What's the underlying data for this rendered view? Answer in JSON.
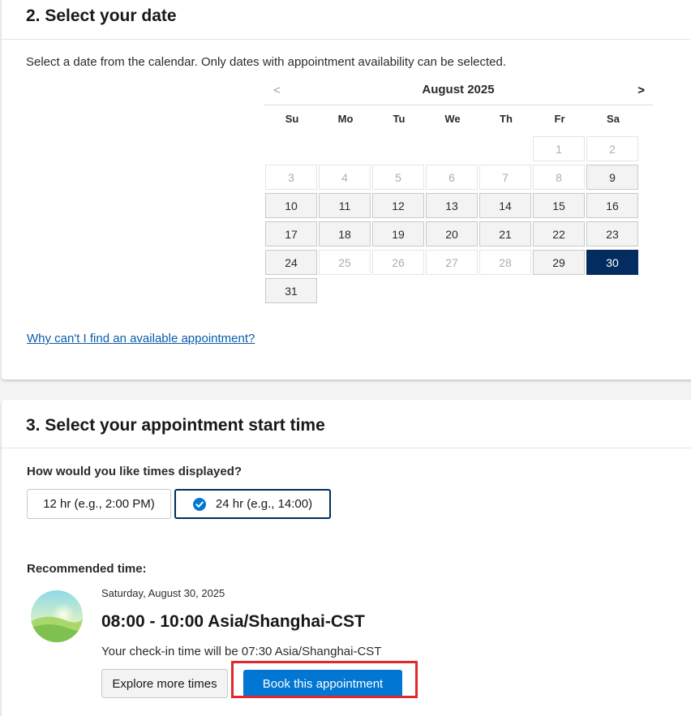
{
  "step2": {
    "title": "2. Select your date",
    "instruction": "Select a date from the calendar. Only dates with appointment availability can be selected.",
    "help_link": "Why can't I find an available appointment?"
  },
  "calendar": {
    "month_label": "August 2025",
    "prev_label": "<",
    "next_label": ">",
    "weekdays": [
      "Su",
      "Mo",
      "Tu",
      "We",
      "Th",
      "Fr",
      "Sa"
    ],
    "first_weekday_index": 5,
    "days": [
      {
        "day": "1",
        "state": "disabled"
      },
      {
        "day": "2",
        "state": "disabled"
      },
      {
        "day": "3",
        "state": "disabled"
      },
      {
        "day": "4",
        "state": "disabled"
      },
      {
        "day": "5",
        "state": "disabled"
      },
      {
        "day": "6",
        "state": "disabled"
      },
      {
        "day": "7",
        "state": "disabled"
      },
      {
        "day": "8",
        "state": "disabled"
      },
      {
        "day": "9",
        "state": "available"
      },
      {
        "day": "10",
        "state": "available"
      },
      {
        "day": "11",
        "state": "available"
      },
      {
        "day": "12",
        "state": "available"
      },
      {
        "day": "13",
        "state": "available"
      },
      {
        "day": "14",
        "state": "available"
      },
      {
        "day": "15",
        "state": "available"
      },
      {
        "day": "16",
        "state": "available"
      },
      {
        "day": "17",
        "state": "available"
      },
      {
        "day": "18",
        "state": "available"
      },
      {
        "day": "19",
        "state": "available"
      },
      {
        "day": "20",
        "state": "available"
      },
      {
        "day": "21",
        "state": "available"
      },
      {
        "day": "22",
        "state": "available"
      },
      {
        "day": "23",
        "state": "available"
      },
      {
        "day": "24",
        "state": "available"
      },
      {
        "day": "25",
        "state": "disabled"
      },
      {
        "day": "26",
        "state": "disabled"
      },
      {
        "day": "27",
        "state": "disabled"
      },
      {
        "day": "28",
        "state": "disabled"
      },
      {
        "day": "29",
        "state": "available"
      },
      {
        "day": "30",
        "state": "selected"
      },
      {
        "day": "31",
        "state": "available"
      }
    ]
  },
  "step3": {
    "title": "3. Select your appointment start time",
    "question": "How would you like times displayed?",
    "format_12": "12 hr (e.g., 2:00 PM)",
    "format_24": "24 hr (e.g., 14:00)",
    "selected_format": "24",
    "recommended_label": "Recommended time:",
    "rec_date": "Saturday, August 30, 2025",
    "rec_time": "08:00 - 10:00 Asia/Shanghai-CST",
    "rec_checkin": "Your check-in time will be 07:30 Asia/Shanghai-CST",
    "explore_label": "Explore more times",
    "book_label": "Book this appointment"
  },
  "colors": {
    "selected_day": "#032d60",
    "book_button": "#0176d3",
    "link": "#0b5cab",
    "highlight": "#e0292c",
    "check_icon": "#0176d3"
  },
  "icons": {
    "prev": "chevron-left-icon",
    "next": "chevron-right-icon",
    "selected_format": "check-circle-icon",
    "recommended": "landscape-avatar-icon"
  }
}
